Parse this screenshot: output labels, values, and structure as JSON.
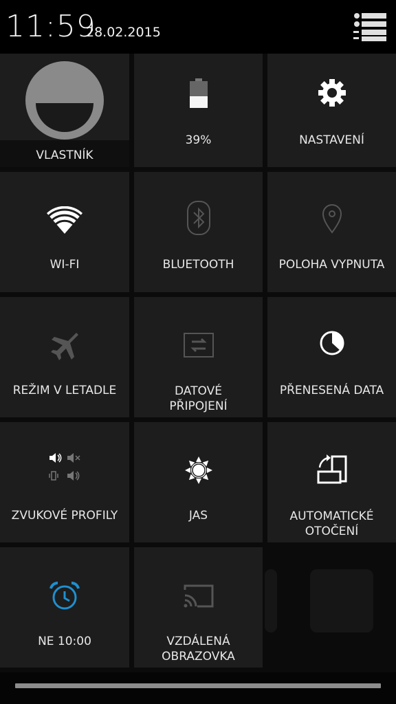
{
  "status_bar": {
    "time": "11:59",
    "date": "28.02.2015"
  },
  "tiles": [
    {
      "id": "owner",
      "label": "VLASTNÍK",
      "icon": "user-avatar-icon"
    },
    {
      "id": "battery",
      "label": "39%",
      "icon": "battery-icon"
    },
    {
      "id": "settings",
      "label": "NASTAVENÍ",
      "icon": "gear-icon"
    },
    {
      "id": "wifi",
      "label": "WI-FI",
      "icon": "wifi-icon"
    },
    {
      "id": "bluetooth",
      "label": "BLUETOOTH",
      "icon": "bluetooth-icon"
    },
    {
      "id": "location",
      "label": "POLOHA VYPNUTA",
      "icon": "location-pin-icon"
    },
    {
      "id": "airplane",
      "label": "REŽIM V LETADLE",
      "icon": "airplane-icon"
    },
    {
      "id": "data",
      "label": "DATOVÉ\nPŘIPOJENÍ",
      "icon": "data-transfer-icon"
    },
    {
      "id": "data_usage",
      "label": "PŘENESENÁ DATA",
      "icon": "data-usage-icon"
    },
    {
      "id": "sound",
      "label": "ZVUKOVÉ PROFILY",
      "icon": "sound-profiles-icon"
    },
    {
      "id": "brightness",
      "label": "JAS",
      "icon": "brightness-icon"
    },
    {
      "id": "rotation",
      "label": "AUTOMATICKÉ\nOTOČENÍ",
      "icon": "auto-rotate-icon"
    },
    {
      "id": "alarm",
      "label": "NE 10:00",
      "icon": "alarm-clock-icon"
    },
    {
      "id": "cast",
      "label": "VZDÁLENÁ\nOBRAZOVKA",
      "icon": "cast-screen-icon"
    }
  ],
  "colors": {
    "tile_bg": "#1d1d1d",
    "accent_alarm": "#1e90d0",
    "icon_active": "#ffffff",
    "icon_inactive": "#555555"
  }
}
